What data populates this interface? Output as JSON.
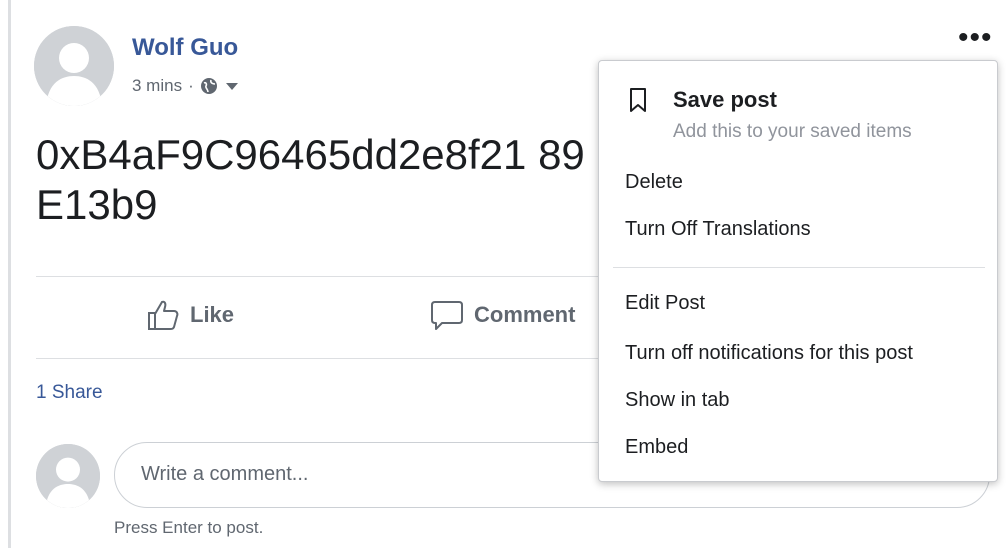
{
  "post": {
    "author": "Wolf Guo",
    "time": "3 mins",
    "separator": "·",
    "text": "0xB4aF9C96465dd2e8f21 89E13b9",
    "more_glyph": "•••"
  },
  "actions": {
    "like": "Like",
    "comment": "Comment"
  },
  "shares": "1 Share",
  "comment_box": {
    "placeholder": "Write a comment...",
    "hint": "Press Enter to post."
  },
  "menu": {
    "save_title": "Save post",
    "save_subtitle": "Add this to your saved items",
    "items": [
      "Delete",
      "Turn Off Translations",
      "Edit Post",
      "Turn off notifications for this post",
      "Show in tab",
      "Embed"
    ]
  },
  "icons": {
    "avatar": "default-avatar-icon",
    "privacy": "globe-icon",
    "like": "thumbs-up-icon",
    "comment": "speech-bubble-icon",
    "save": "bookmark-icon"
  },
  "colors": {
    "link": "#385898",
    "text": "#1c1e21",
    "muted": "#606770",
    "divider": "#dddfe2"
  }
}
